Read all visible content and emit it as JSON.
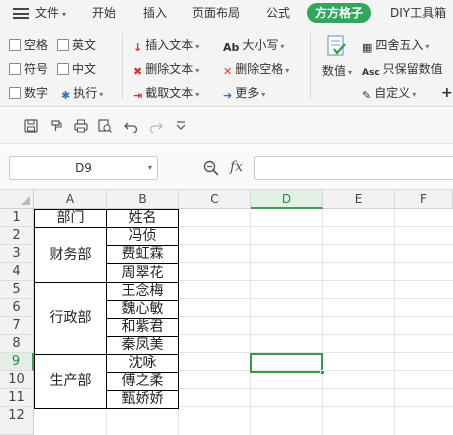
{
  "menubar": {
    "file_label": "文件",
    "tabs": [
      "开始",
      "插入",
      "页面布局",
      "公式",
      "方方格子",
      "DIY工具箱"
    ],
    "active_tab": "方方格子"
  },
  "ribbon": {
    "checkboxes": [
      "空格",
      "英文",
      "符号",
      "中文",
      "数字"
    ],
    "execute": "执行",
    "text_ops": [
      "插入文本",
      "删除文本",
      "截取文本"
    ],
    "case_ops": [
      "大小写",
      "删除空格",
      "更多"
    ],
    "value_button": "数值",
    "round_ops": [
      "四舍五入",
      "只保留数值",
      "自定义"
    ],
    "plus": "+"
  },
  "formula_bar": {
    "name_box": "D9",
    "fx": "fx",
    "formula": ""
  },
  "grid": {
    "columns": [
      "A",
      "B",
      "C",
      "D",
      "E",
      "F"
    ],
    "rows": [
      "1",
      "2",
      "3",
      "4",
      "5",
      "6",
      "7",
      "8",
      "9",
      "10",
      "11",
      "12"
    ],
    "selected_column": "D",
    "selected_row": "9",
    "header_dept": "部门",
    "header_name": "姓名",
    "departments": [
      "财务部",
      "行政部",
      "生产部"
    ],
    "names": [
      "冯侦",
      "费虹霖",
      "周翠花",
      "王念梅",
      "魏心敏",
      "和紫君",
      "秦凤美",
      "沈咏",
      "傅之柔",
      "甄娇娇"
    ]
  },
  "colors": {
    "accent_green": "#2ea85a",
    "selection_green": "#2f9e44",
    "icon_red": "#d9342b",
    "icon_blue": "#2f6fd1"
  }
}
